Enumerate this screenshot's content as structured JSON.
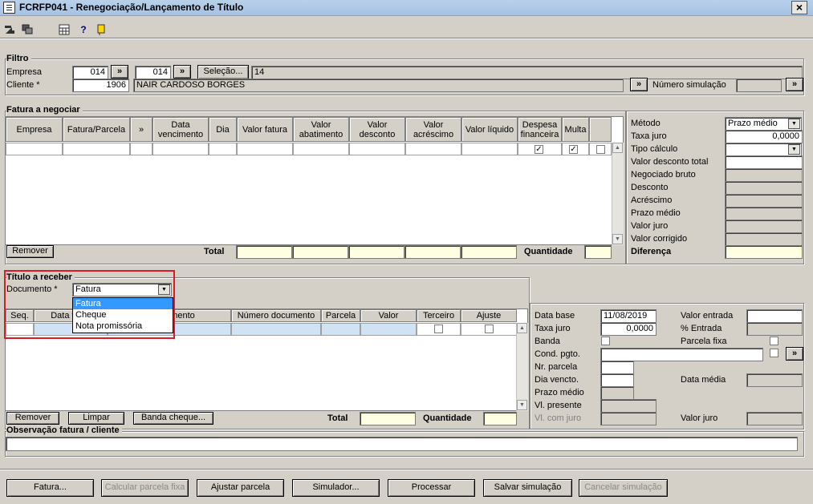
{
  "window": {
    "title": "FCRFP041 - Renegociação/Lançamento de Título",
    "close_label": "×"
  },
  "toolbar": {
    "icons": [
      "exit-icon",
      "windows-icon",
      "calculator-icon",
      "help-icon",
      "bookmark-icon"
    ]
  },
  "filtro": {
    "label": "Filtro",
    "empresa_label": "Empresa",
    "empresa_from": "014",
    "empresa_to": "014",
    "selecao_button": "Seleção...",
    "selecao_value": "14",
    "cliente_label": "Cliente *",
    "cliente_code": "1906",
    "cliente_name": "NAIR CARDOSO BORGES",
    "numero_simulacao_label": "Número simulação",
    "numero_simulacao_value": "",
    "arrow": "»"
  },
  "fatura": {
    "label": "Fatura a negociar",
    "columns": [
      "Empresa",
      "Fatura/Parcela",
      "»",
      "Data vencimento",
      "Dia",
      "Valor fatura",
      "Valor abatimento",
      "Valor desconto",
      "Valor acréscimo",
      "Valor líquido",
      "Despesa financeira",
      "Multa",
      ""
    ],
    "remover_button": "Remover",
    "total_label": "Total",
    "quantidade_label": "Quantidade"
  },
  "metodo_panel": {
    "metodo_label": "Método",
    "metodo_value": "Prazo médio",
    "taxa_juro_label": "Taxa juro",
    "taxa_juro_value": "0,0000",
    "tipo_calculo_label": "Tipo cálculo",
    "valor_desconto_total_label": "Valor desconto total",
    "negociado_bruto_label": "Negociado bruto",
    "desconto_label": "Desconto",
    "acrescimo_label": "Acréscimo",
    "prazo_medio_label": "Prazo médio",
    "valor_juro_label": "Valor juro",
    "valor_corrigido_label": "Valor corrigido",
    "diferenca_label": "Diferença"
  },
  "titulo": {
    "label": "Título a receber",
    "documento_label": "Documento *",
    "documento_value": "Fatura",
    "documento_options": [
      "Fatura",
      "Cheque",
      "Nota promissória"
    ],
    "columns": [
      "Seq.",
      "Data venc",
      "o documento",
      "Número documento",
      "Parcela",
      "Valor",
      "Terceiro",
      "Ajuste"
    ],
    "remover_button": "Remover",
    "limpar_button": "Limpar",
    "banda_cheque_button": "Banda cheque...",
    "total_label": "Total",
    "quantidade_label": "Quantidade"
  },
  "titulo_panel": {
    "data_base_label": "Data base",
    "data_base_value": "11/08/2019",
    "taxa_juro_label": "Taxa juro",
    "taxa_juro_value": "0,0000",
    "banda_label": "Banda",
    "cond_pgto_label": "Cond. pgto.",
    "nr_parcela_label": "Nr. parcela",
    "dia_vencto_label": "Dia vencto.",
    "prazo_medio_label": "Prazo médio",
    "vl_presente_label": "Vl. presente",
    "vl_com_juro_label": "Vl. com juro",
    "valor_entrada_label": "Valor entrada",
    "pct_entrada_label": "% Entrada",
    "parcela_fixa_label": "Parcela fixa",
    "data_media_label": "Data média",
    "valor_juro_label": "Valor juro"
  },
  "observacao": {
    "label": "Observação fatura / cliente",
    "value": ""
  },
  "footer": {
    "fatura_button": "Fatura...",
    "calcular_button": "Calcular parcela fixa",
    "ajustar_button": "Ajustar parcela",
    "simulador_button": "Simulador...",
    "processar_button": "Processar",
    "salvar_button": "Salvar simulação",
    "cancelar_button": "Cancelar simulação"
  }
}
